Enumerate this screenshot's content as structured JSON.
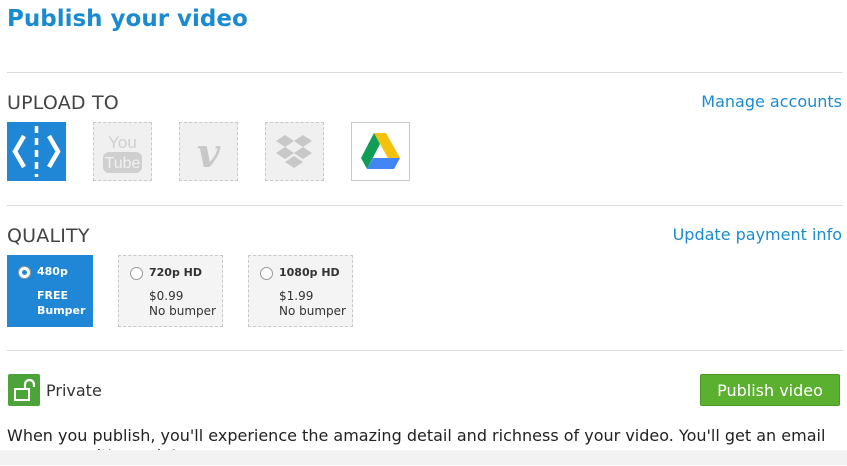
{
  "page": {
    "title": "Publish your video"
  },
  "upload": {
    "label": "UPLOAD TO",
    "manage_link": "Manage accounts",
    "services": [
      {
        "icon": "camtasia-icon",
        "selected": true
      },
      {
        "icon": "youtube-icon",
        "name_line1": "You",
        "name_line2": "Tube",
        "selected": false
      },
      {
        "icon": "vimeo-icon",
        "name": "v",
        "selected": false
      },
      {
        "icon": "dropbox-icon",
        "selected": false
      },
      {
        "icon": "google-drive-icon",
        "selected": false
      }
    ]
  },
  "quality": {
    "label": "QUALITY",
    "payment_link": "Update payment info",
    "options": [
      {
        "name": "480p",
        "price": "FREE",
        "bumper": "Bumper",
        "selected": true
      },
      {
        "name": "720p HD",
        "price": "$0.99",
        "bumper": "No bumper",
        "selected": false
      },
      {
        "name": "1080p HD",
        "price": "$1.99",
        "bumper": "No bumper",
        "selected": false
      }
    ]
  },
  "privacy": {
    "label": "Private",
    "icon": "unlock-icon"
  },
  "actions": {
    "publish_label": "Publish video"
  },
  "note": "When you publish, you'll experience the amazing detail and richness of your video. You'll get an email as soon as it's ready!",
  "colors": {
    "accent": "#1b8bd1",
    "selected": "#1f87d5",
    "publish": "#5cb030",
    "lock": "#4ba33a"
  }
}
